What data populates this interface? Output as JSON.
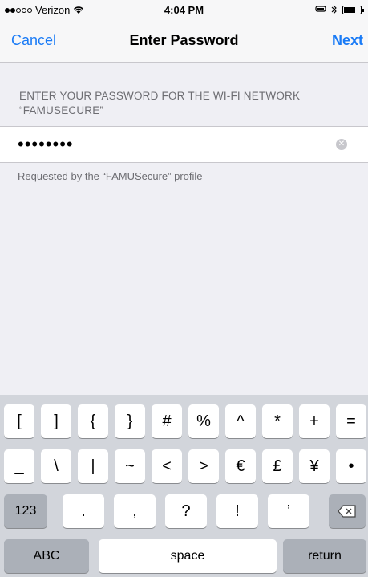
{
  "status_bar": {
    "carrier": "Verizon",
    "time": "4:04 PM"
  },
  "nav": {
    "cancel_label": "Cancel",
    "title": "Enter Password",
    "next_label": "Next"
  },
  "section": {
    "header": "ENTER YOUR PASSWORD FOR THE WI-FI NETWORK “FAMUSECURE”",
    "password_value": "••••••••",
    "footer": "Requested by the “FAMUSecure” profile"
  },
  "keyboard": {
    "row1": [
      "[",
      "]",
      "{",
      "}",
      "#",
      "%",
      "^",
      "*",
      "+",
      "="
    ],
    "row2": [
      "_",
      "\\",
      "|",
      "~",
      "<",
      ">",
      "€",
      "£",
      "¥",
      "•"
    ],
    "row3": [
      "123",
      ".",
      ",",
      "?",
      "!",
      "’"
    ],
    "bottom": {
      "abc": "ABC",
      "space": "space",
      "return": "return"
    }
  }
}
